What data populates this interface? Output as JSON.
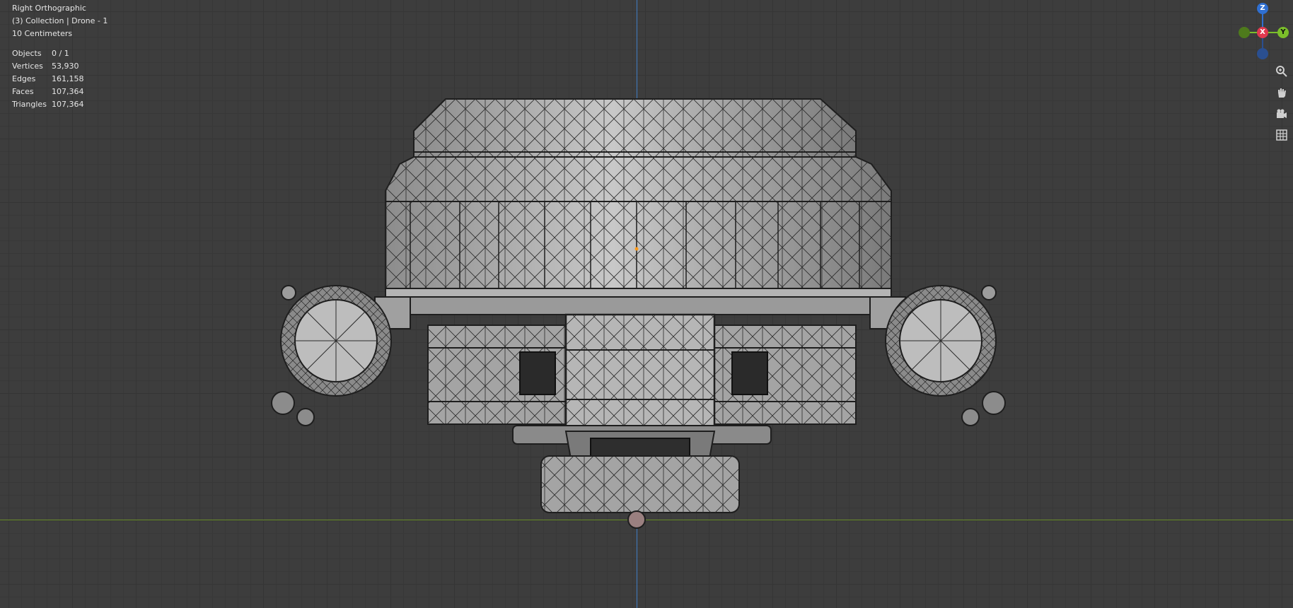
{
  "viewport": {
    "view_name": "Right Orthographic",
    "collection_line": "(3) Collection | Drone - 1",
    "scale_line": "10 Centimeters",
    "stats": [
      {
        "label": "Objects",
        "value": "0 / 1"
      },
      {
        "label": "Vertices",
        "value": "53,930"
      },
      {
        "label": "Edges",
        "value": "161,158"
      },
      {
        "label": "Faces",
        "value": "107,364"
      },
      {
        "label": "Triangles",
        "value": "107,364"
      }
    ]
  },
  "gizmo": {
    "z_label": "Z",
    "x_label": "X",
    "y_label": "Y",
    "z_color": "#2f6fd1",
    "x_color": "#e0394f",
    "y_color": "#7bbf2a"
  },
  "toolbar": {
    "zoom_icon": "zoom-icon",
    "pan_icon": "hand-pan-icon",
    "camera_icon": "camera-icon",
    "grid_icon": "grid-view-icon"
  },
  "colors": {
    "background": "#3d3d3d",
    "axis_vertical": "#3f7cc2",
    "axis_horizontal": "#6b8f2c"
  }
}
